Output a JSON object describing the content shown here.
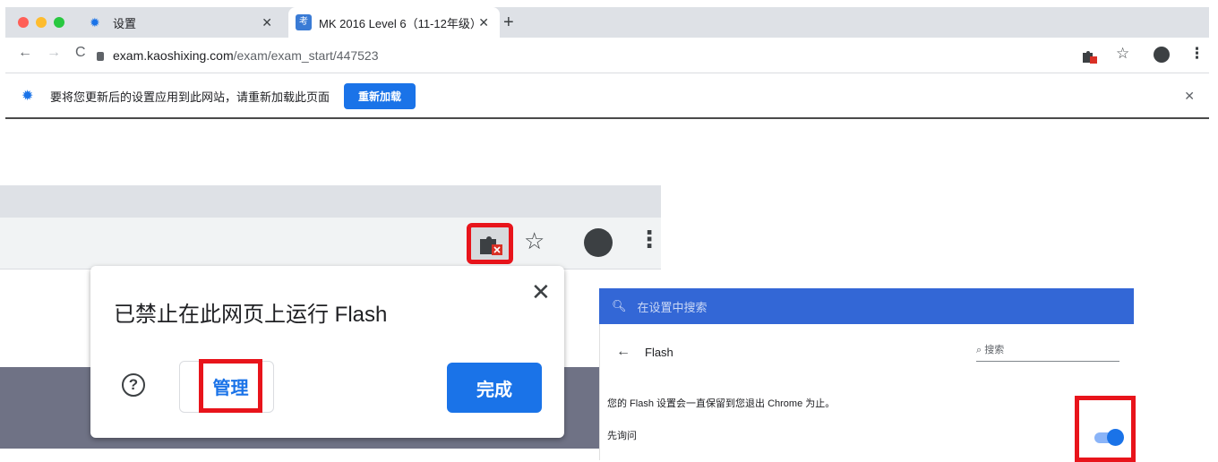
{
  "browser": {
    "tabs": [
      {
        "title": "设置",
        "icon": "gear-icon",
        "active": false
      },
      {
        "title": "MK 2016 Level 6（11-12年级）",
        "icon": "kaoshixing-favicon",
        "active": true
      }
    ],
    "new_tab_glyph": "+",
    "tab_close_glyph": "✕",
    "nav": {
      "back": "←",
      "forward": "→",
      "reload": "C"
    },
    "address": {
      "host": "exam.kaoshixing.com",
      "path": "/exam/exam_start/447523"
    },
    "toolbar_icons": [
      "extension-blocked-icon",
      "star-icon",
      "account-icon",
      "menu-icon"
    ],
    "star_glyph": "☆",
    "menu_glyph": "⋮",
    "infobar": {
      "message": "要将您更新后的设置应用到此网站，请重新加载此页面",
      "button": "重新加载",
      "close": "✕"
    }
  },
  "popup": {
    "title": "已禁止在此网页上运行 Flash",
    "close": "✕",
    "help": "?",
    "manage": "管理",
    "done": "完成"
  },
  "settings": {
    "search_placeholder": "在设置中搜索",
    "back": "←",
    "title": "Flash",
    "sub_search": "搜索",
    "note": "您的 Flash 设置会一直保留到您退出 Chrome 为止。",
    "ask_label": "先询问",
    "ask_enabled": true
  },
  "colors": {
    "accent": "#1a73e8",
    "highlight": "#e8141b",
    "settings_header": "#3367d6"
  }
}
